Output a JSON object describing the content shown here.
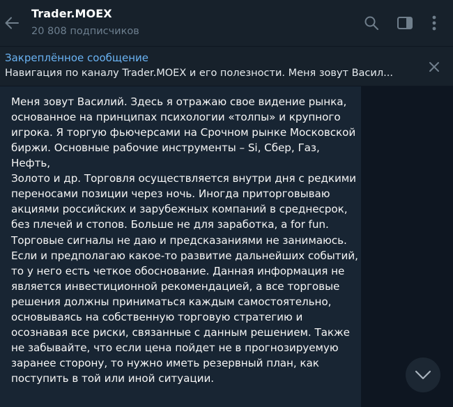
{
  "header": {
    "title": "Trader.MOEX",
    "subscribers": "20 808 подписчиков",
    "icons": [
      "back-arrow-icon",
      "search-icon",
      "sidebar-panel-icon",
      "more-vertical-icon"
    ]
  },
  "pinned": {
    "title": "Закреплённое сообщение",
    "text": "Навигация по каналу Trader.MOEX и его полезности.  Меня зовут Васил..."
  },
  "message": {
    "paragraph1": "Меня зовут Василий. Здесь я отражаю свое видение рынка,\nоснованное на принципах психологии «толпы» и крупного\nигрока. Я торгую фьючерсами на Срочном рынке Московской\nбиржи. Основные рабочие инструменты – Si, Сбер, Газ, Нефть,\nЗолото и др. Торговля осуществляется внутри дня с редкими\nпереносами позиции через ночь. Иногда приторговываю\nакциями российских и зарубежных компаний в среднесрок,\nбез плечей и стопов. Больше не для заработка, а for fun.",
    "paragraph2": "Торговые сигналы не даю и предсказаниями не занимаюсь.\nЕсли и предполагаю какое-то развитие дальнейших событий,\nто у него есть четкое обоснование. Данная информация не\nявляется инвестиционной рекомендацией, а все торговые\nрешения должны приниматься каждым самостоятельно,\nосновываясь на собственную торговую стратегию и\nосознавая все риски, связанные с данным решением. Также\nне забывайте, что если цена пойдет не в прогнозируемую\nзаранее сторону, то нужно иметь резервный план, как\nпоступить в той или иной ситуации."
  },
  "colors": {
    "background": "#0e1621",
    "header": "#17212b",
    "bubble": "#182533",
    "accent": "#6ab3f3",
    "muted": "#6d7f8f"
  }
}
